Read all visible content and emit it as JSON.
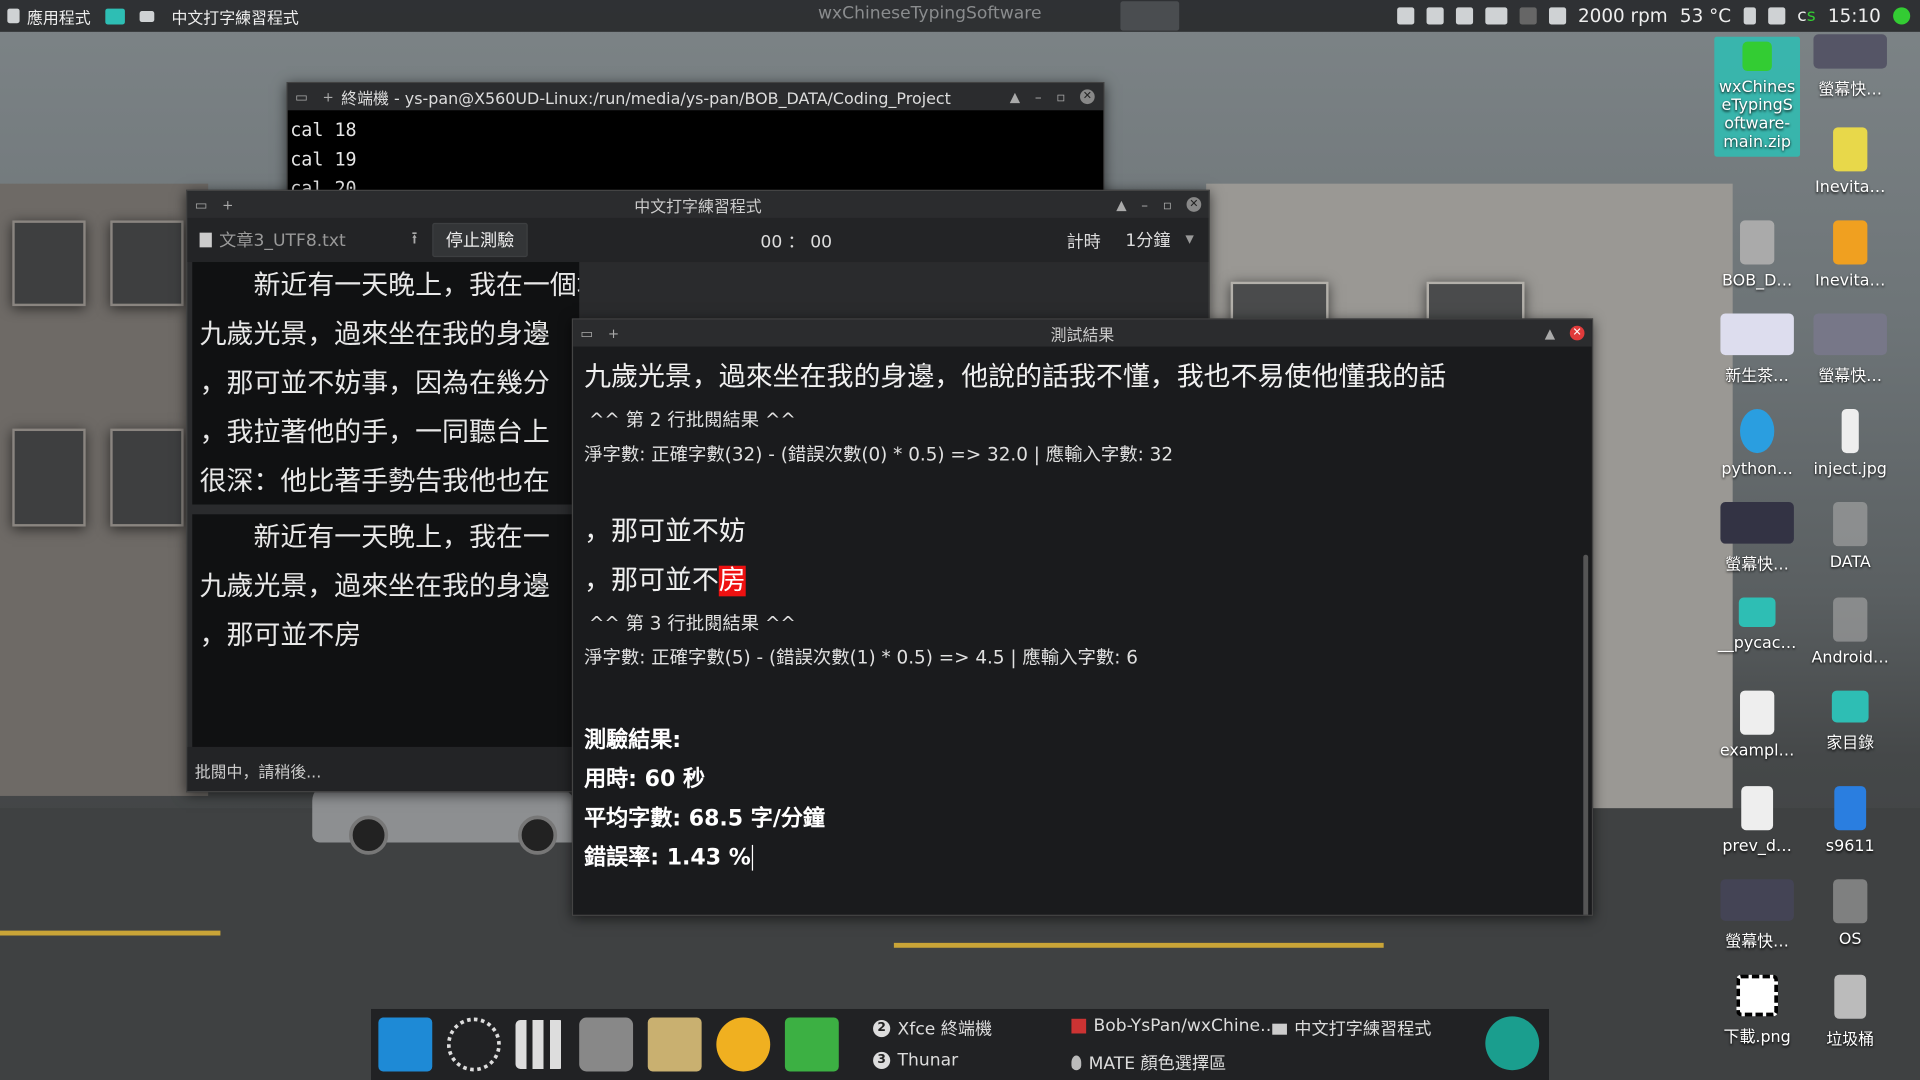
{
  "panel": {
    "apps_menu": "應用程式",
    "active_window": "中文打字練習程式",
    "center_title": "wxChineseTypingSoftware",
    "fan": "2000 rpm",
    "temp": "53 °C",
    "clock": "15:10",
    "tray_text": "c",
    "tray_text2": "s"
  },
  "terminal": {
    "title": "終端機 - ys-pan@X560UD-Linux:/run/media/ys-pan/BOB_DATA/Coding_Project",
    "lines": [
      "cal 18",
      "cal 19",
      "cal 20"
    ]
  },
  "app": {
    "title": "中文打字練習程式",
    "file": "文章3_UTF8.txt",
    "stop_button": "停止測驗",
    "timer": "00 ： 00",
    "timing_label": "計時",
    "duration": "1分鐘",
    "source_lines": [
      "新近有一天晚上，我在一個地方聽音樂，一個不相識的小孩，約莫八",
      "九歲光景，過來坐在我的身邊",
      "，那可並不妨事，因為在幾分",
      "，我拉著他的手，一同聽台上",
      "很深：他比著手勢告我他也在"
    ],
    "typed_lines": [
      "新近有一天晚上，我在一",
      "九歲光景，過來坐在我的身邊",
      "，那可並不房"
    ],
    "status": "批閱中，請稍後..."
  },
  "result": {
    "title": "測試結果",
    "line2_text": "九歲光景，過來坐在我的身邊，他說的話我不懂，我也不易使他懂我的話",
    "line2_header": "^^ 第 2 行批閱結果 ^^",
    "line2_score": "淨字數: 正確字數(32) - (錯誤次數(0) * 0.5) => 32.0 | 應輸入字數: 32",
    "line3_expected": "，那可並不妨",
    "line3_typed_ok": "，那可並不",
    "line3_typed_err": "房",
    "line3_header": "^^ 第 3 行批閱結果 ^^",
    "line3_score": "淨字數: 正確字數(5) - (錯誤次數(1) * 0.5) => 4.5 | 應輸入字數: 6",
    "summary_title": "測驗結果:",
    "time_used": "用時: 60 秒",
    "avg_speed": "平均字數: 68.5 字/分鐘",
    "error_rate": "錯誤率: 1.43 %"
  },
  "desktop_icons": [
    {
      "label": "wxChineseTypingSoftware-main.zip",
      "short1": "wxChines",
      "short2": "eTypingS",
      "short3": "oftware-",
      "short4": "main.zip"
    },
    {
      "label": "螢幕快…"
    },
    {
      "label": "Inevita…"
    },
    {
      "label": "BOB_D…"
    },
    {
      "label": "Inevita…"
    },
    {
      "label": "新生茶…"
    },
    {
      "label": "螢幕快…"
    },
    {
      "label": "python…"
    },
    {
      "label": "inject.jpg"
    },
    {
      "label": "螢幕快…"
    },
    {
      "label": "DATA"
    },
    {
      "label": "__pycac…"
    },
    {
      "label": "Android…"
    },
    {
      "label": "exampl…"
    },
    {
      "label": "家目錄"
    },
    {
      "label": "prev_d…"
    },
    {
      "label": "s9611"
    },
    {
      "label": "螢幕快…"
    },
    {
      "label": "OS"
    },
    {
      "label": "下載.png"
    },
    {
      "label": "垃圾桶"
    }
  ],
  "taskbar": {
    "tasks": [
      {
        "label": "Xfce 終端機",
        "badge": "2"
      },
      {
        "label": "Bob-YsPan/wxChine…"
      },
      {
        "label": "中文打字練習程式"
      },
      {
        "label": "Thunar",
        "badge": "3"
      },
      {
        "label": "MATE 顏色選擇區"
      }
    ]
  },
  "colors": {
    "accent": "#2ebeb4",
    "error": "#e11111",
    "close": "#e03b3b"
  }
}
